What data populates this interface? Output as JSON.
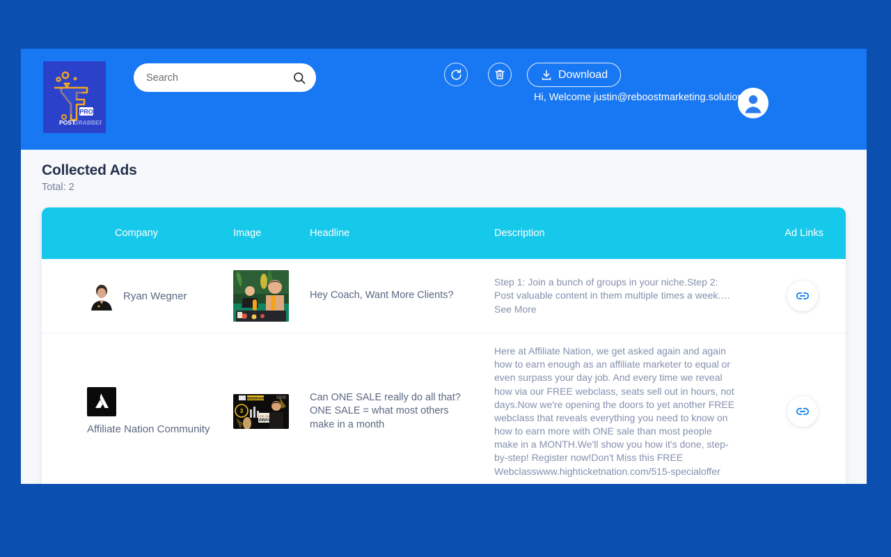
{
  "theme": {
    "page_background": "#0b4fb0",
    "header_blue": "#1877f2",
    "table_header_cyan": "#16c8ea",
    "accent_link": "#1e88f0",
    "logo_tile": "#2b41c9",
    "logo_mark": "#f5a623"
  },
  "header": {
    "logo": {
      "icon": "funnel-f-logo",
      "badge_text": "PRO",
      "wordmark_bold": "POST",
      "wordmark_light": "GRABBER"
    },
    "search": {
      "placeholder": "Search",
      "value": "",
      "icon": "search-icon"
    },
    "refresh_button": {
      "icon": "refresh-icon",
      "label": "Refresh"
    },
    "delete_button": {
      "icon": "trash-icon",
      "label": "Delete"
    },
    "download_button": {
      "icon": "download-icon",
      "label": "Download"
    },
    "welcome_text": "Hi, Welcome justin@reboostmarketing.solutions",
    "avatar": {
      "icon": "user-avatar-icon"
    }
  },
  "main": {
    "title": "Collected Ads",
    "total_label": "Total: 2",
    "table": {
      "columns": [
        "Company",
        "Image",
        "Headline",
        "Description",
        "Ad Links"
      ],
      "rows": [
        {
          "company": "Ryan Wegner",
          "company_logo": "person-portrait-thumbnail",
          "image": "tropical-pool-breakfast-photo",
          "headline": "Hey Coach, Want More Clients?",
          "description": "Step 1: Join a bunch of groups in your niche.Step 2: Post valuable content in them multiple times a week.… See More",
          "link": {
            "icon": "chain-link-icon",
            "label": "Open ad link"
          }
        },
        {
          "company": "Affiliate Nation Community",
          "company_logo": "black-arrow-logo",
          "image": "webinar-one-sale-away-banner",
          "headline": "Can ONE SALE really do all that? ONE SALE = what most others make in a month",
          "description": "Here at Affiliate Nation, we get asked again and again how to earn enough as an affiliate marketer to equal or even surpass your day job. And every time we reveal how via our FREE webclass, seats sell out in hours, not days.Now we're opening the doors to yet another FREE webclass that reveals everything you need to know on how to earn more with ONE sale than most people make in a MONTH.We'll show you how it's done, step-by-step! Register now!Don't Miss this FREE Webclasswww.highticketnation.com/515-specialoffer",
          "link": {
            "icon": "chain-link-icon",
            "label": "Open ad link"
          }
        }
      ]
    }
  }
}
